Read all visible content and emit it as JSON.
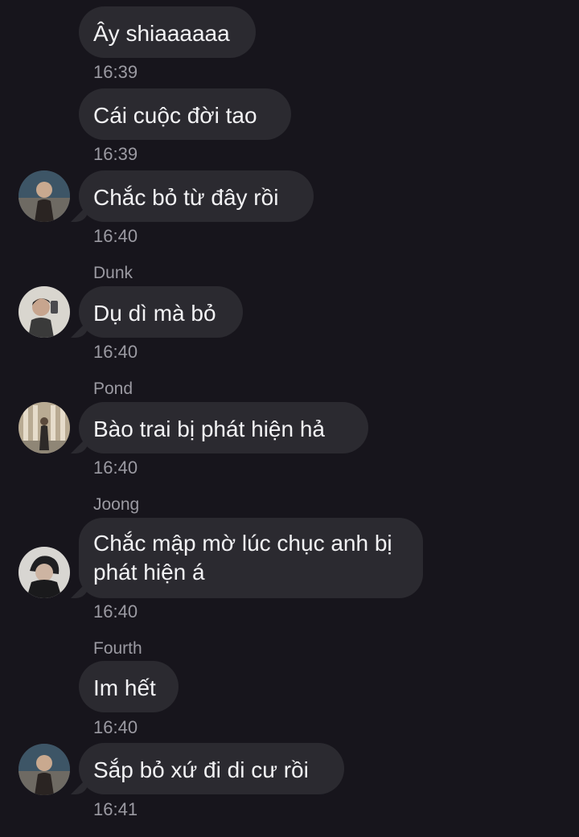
{
  "messages": [
    {
      "text": "Ây shiaaaaaa",
      "time": "16:39"
    },
    {
      "text": "Cái cuộc đời tao",
      "time": "16:39"
    },
    {
      "text": "Chắc bỏ từ đây rồi",
      "time": "16:40",
      "avatar": "avatar-photo-icon"
    },
    {
      "sender": "Dunk",
      "text": "Dụ dì mà bỏ",
      "time": "16:40",
      "avatar": "avatar-photo-icon"
    },
    {
      "sender": "Pond",
      "text": "Bào trai bị phát hiện hả",
      "time": "16:40",
      "avatar": "avatar-photo-icon"
    },
    {
      "sender": "Joong",
      "text": "Chắc mập mờ lúc chục anh bị phát hiện á",
      "time": "16:40",
      "avatar": "avatar-photo-icon"
    },
    {
      "sender": "Fourth",
      "text": "Im hết",
      "time": "16:40"
    },
    {
      "text": "Sắp bỏ xứ đi di cư rồi",
      "time": "16:41",
      "avatar": "avatar-photo-icon"
    }
  ],
  "colors": {
    "background": "#17151c",
    "bubble": "#2b2a30",
    "text": "#f2f2f4",
    "meta": "#9b9aa2"
  }
}
